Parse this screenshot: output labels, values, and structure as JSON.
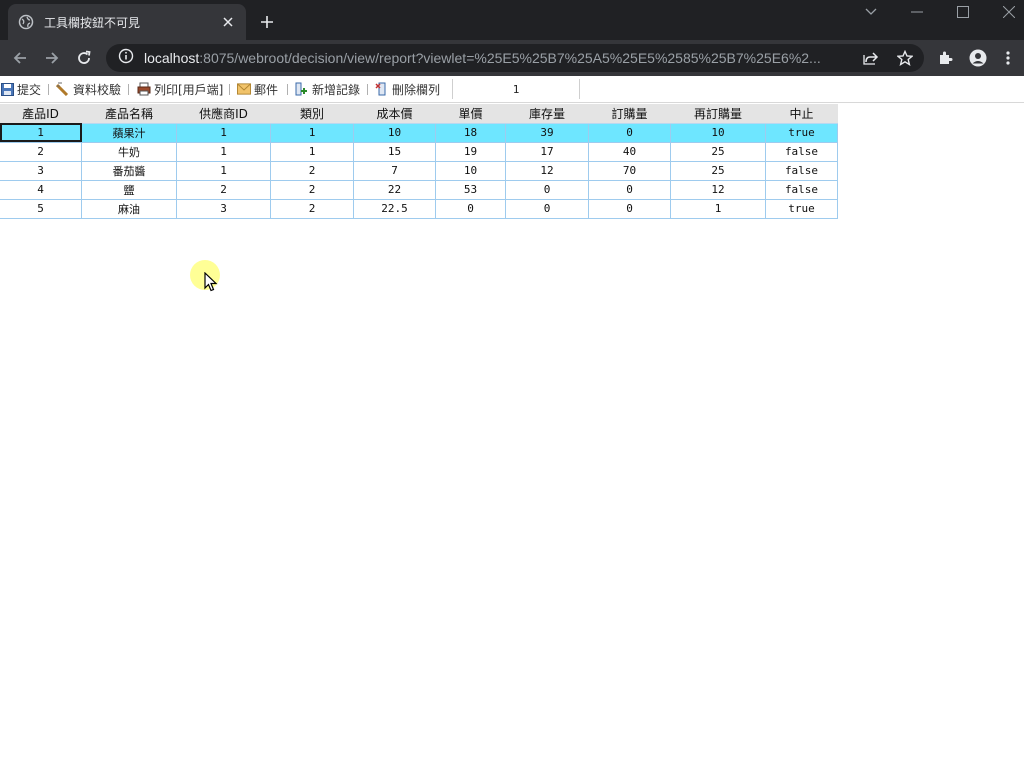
{
  "browser": {
    "tab_title": "工具欄按鈕不可見",
    "url_host": "localhost",
    "url_rest": ":8075/webroot/decision/view/report?viewlet=%25E5%25B7%25A5%25E5%2585%25B7%25E6%2..."
  },
  "report_toolbar": {
    "submit": "提交",
    "verify": "資料校驗",
    "print": "列印[用戶端]",
    "mail": "郵件",
    "add_record": "新增記錄",
    "delete_column": "刪除欄列",
    "page": "1"
  },
  "grid": {
    "headers": [
      "產品ID",
      "產品名稱",
      "供應商ID",
      "類別",
      "成本價",
      "單價",
      "庫存量",
      "訂購量",
      "再訂購量",
      "中止"
    ],
    "rows": [
      [
        "1",
        "蘋果汁",
        "1",
        "1",
        "10",
        "18",
        "39",
        "0",
        "10",
        "true"
      ],
      [
        "2",
        "牛奶",
        "1",
        "1",
        "15",
        "19",
        "17",
        "40",
        "25",
        "false"
      ],
      [
        "3",
        "番茄醬",
        "1",
        "2",
        "7",
        "10",
        "12",
        "70",
        "25",
        "false"
      ],
      [
        "4",
        "鹽",
        "2",
        "2",
        "22",
        "53",
        "0",
        "0",
        "12",
        "false"
      ],
      [
        "5",
        "麻油",
        "3",
        "2",
        "22.5",
        "0",
        "0",
        "0",
        "1",
        "true"
      ]
    ]
  },
  "colors": {
    "selected_row": "#6ee6ff",
    "grid_border": "#9ecbee",
    "header_bg": "#e4e4e4"
  }
}
